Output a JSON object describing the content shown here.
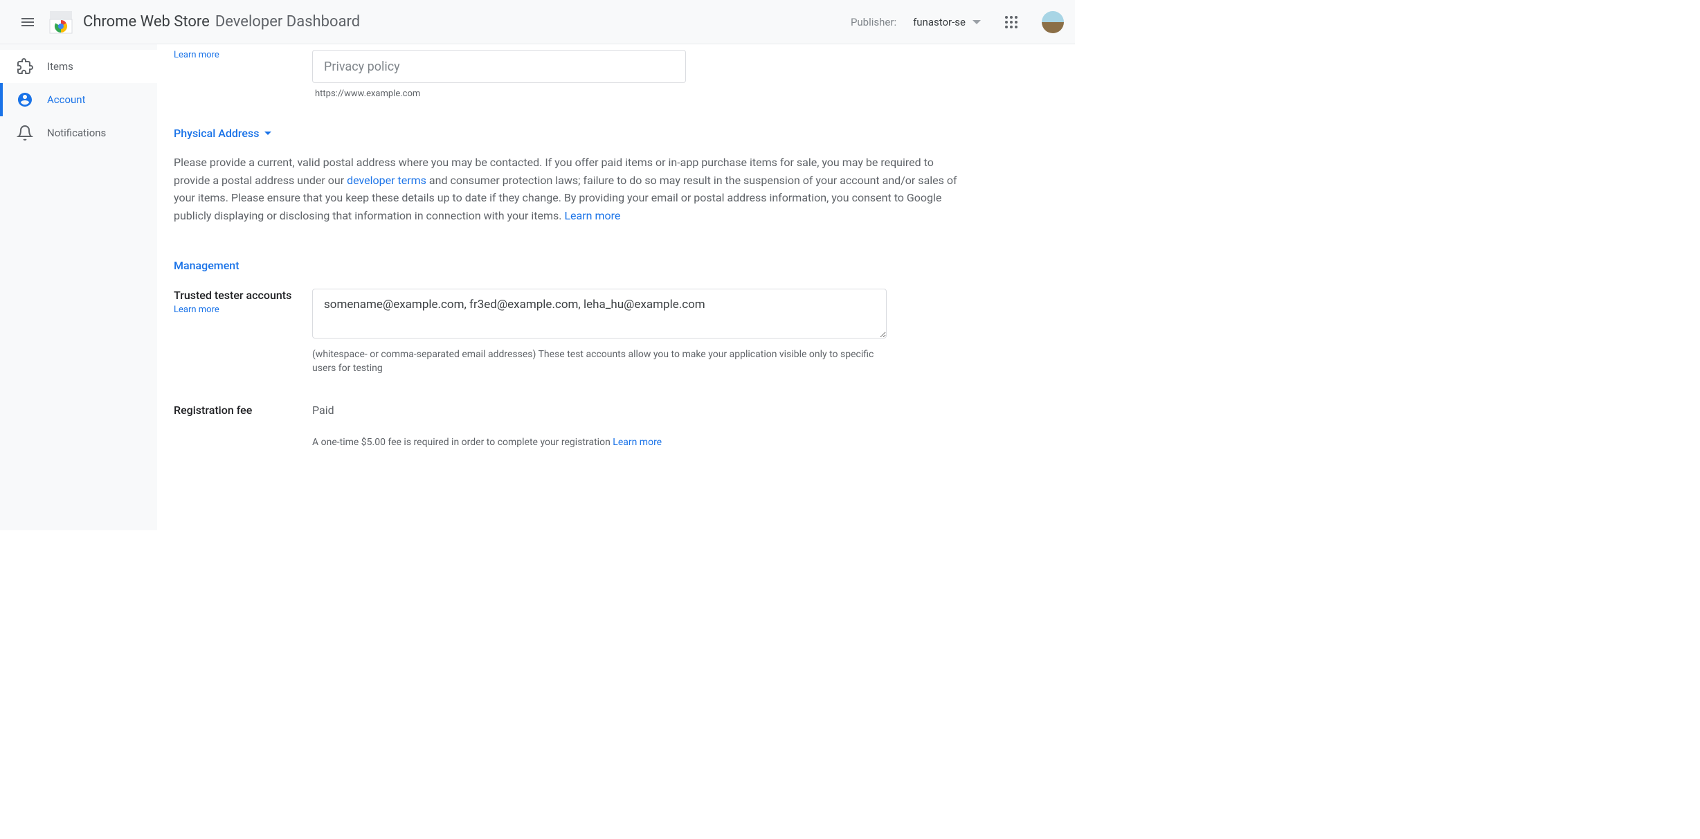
{
  "header": {
    "title_bold": "Chrome Web Store",
    "title_light": "Developer Dashboard",
    "publisher_label": "Publisher:",
    "publisher_value": "funastor-se"
  },
  "sidebar": {
    "items": [
      {
        "label": "Items"
      },
      {
        "label": "Account"
      },
      {
        "label": "Notifications"
      }
    ]
  },
  "privacy": {
    "learn_more": "Learn more",
    "placeholder": "Privacy policy",
    "helper": "https://www.example.com"
  },
  "physical_address": {
    "heading": "Physical Address",
    "desc_part1": "Please provide a current, valid postal address where you may be contacted. If you offer paid items or in-app purchase items for sale, you may be required to provide a postal address under our ",
    "link1": "developer terms",
    "desc_part2": " and consumer protection laws; failure to do so may result in the suspension of your account and/or sales of your items. Please ensure that you keep these details up to date if they change. By providing your email or postal address information, you consent to Google publicly displaying or disclosing that information in connection with your items. ",
    "link2": "Learn more"
  },
  "management": {
    "heading": "Management",
    "trusted_label": "Trusted tester accounts",
    "trusted_learn": "Learn more",
    "trusted_value": "somename@example.com, fr3ed@example.com, leha_hu@example.com",
    "trusted_helper": "(whitespace- or comma-separated email addresses) These test accounts allow you to make your application visible only to specific users for testing",
    "reg_label": "Registration fee",
    "reg_status": "Paid",
    "reg_helper_text": "A one-time $5.00 fee is required in order to complete your registration ",
    "reg_helper_link": "Learn more"
  }
}
